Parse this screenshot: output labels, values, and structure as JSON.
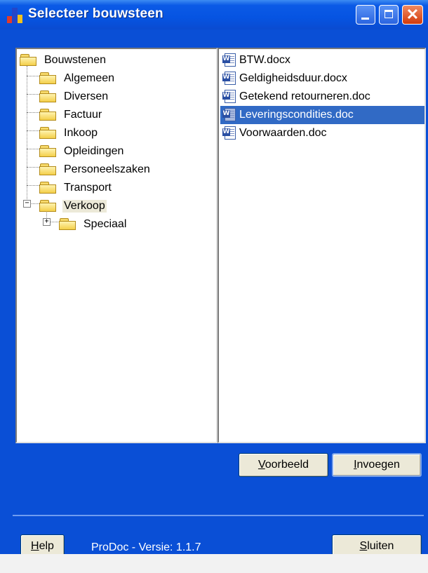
{
  "window": {
    "title": "Selecteer bouwsteen",
    "colors": {
      "frame": "#0a4fd6",
      "selection": "#316ac5",
      "button_face": "#ece9d8"
    }
  },
  "tree": {
    "root": "Bouwstenen",
    "children": [
      "Algemeen",
      "Diversen",
      "Factuur",
      "Inkoop",
      "Opleidingen",
      "Personeelszaken",
      "Transport",
      "Verkoop"
    ],
    "selected": "Verkoop",
    "verkoop_children": [
      "Speciaal"
    ]
  },
  "files": {
    "items": [
      "BTW.docx",
      "Geldigheidsduur.docx",
      "Getekend retourneren.doc",
      "Leveringscondities.doc",
      "Voorwaarden.doc"
    ],
    "selected": "Leveringscondities.doc"
  },
  "buttons": {
    "preview": {
      "mnemonic": "V",
      "rest": "oorbeeld"
    },
    "insert": {
      "mnemonic": "I",
      "rest": "nvoegen"
    },
    "help": {
      "mnemonic": "H",
      "rest": "elp"
    },
    "close": {
      "mnemonic": "S",
      "rest": "luiten"
    }
  },
  "footer": {
    "version": "ProDoc - Versie: 1.1.7"
  }
}
